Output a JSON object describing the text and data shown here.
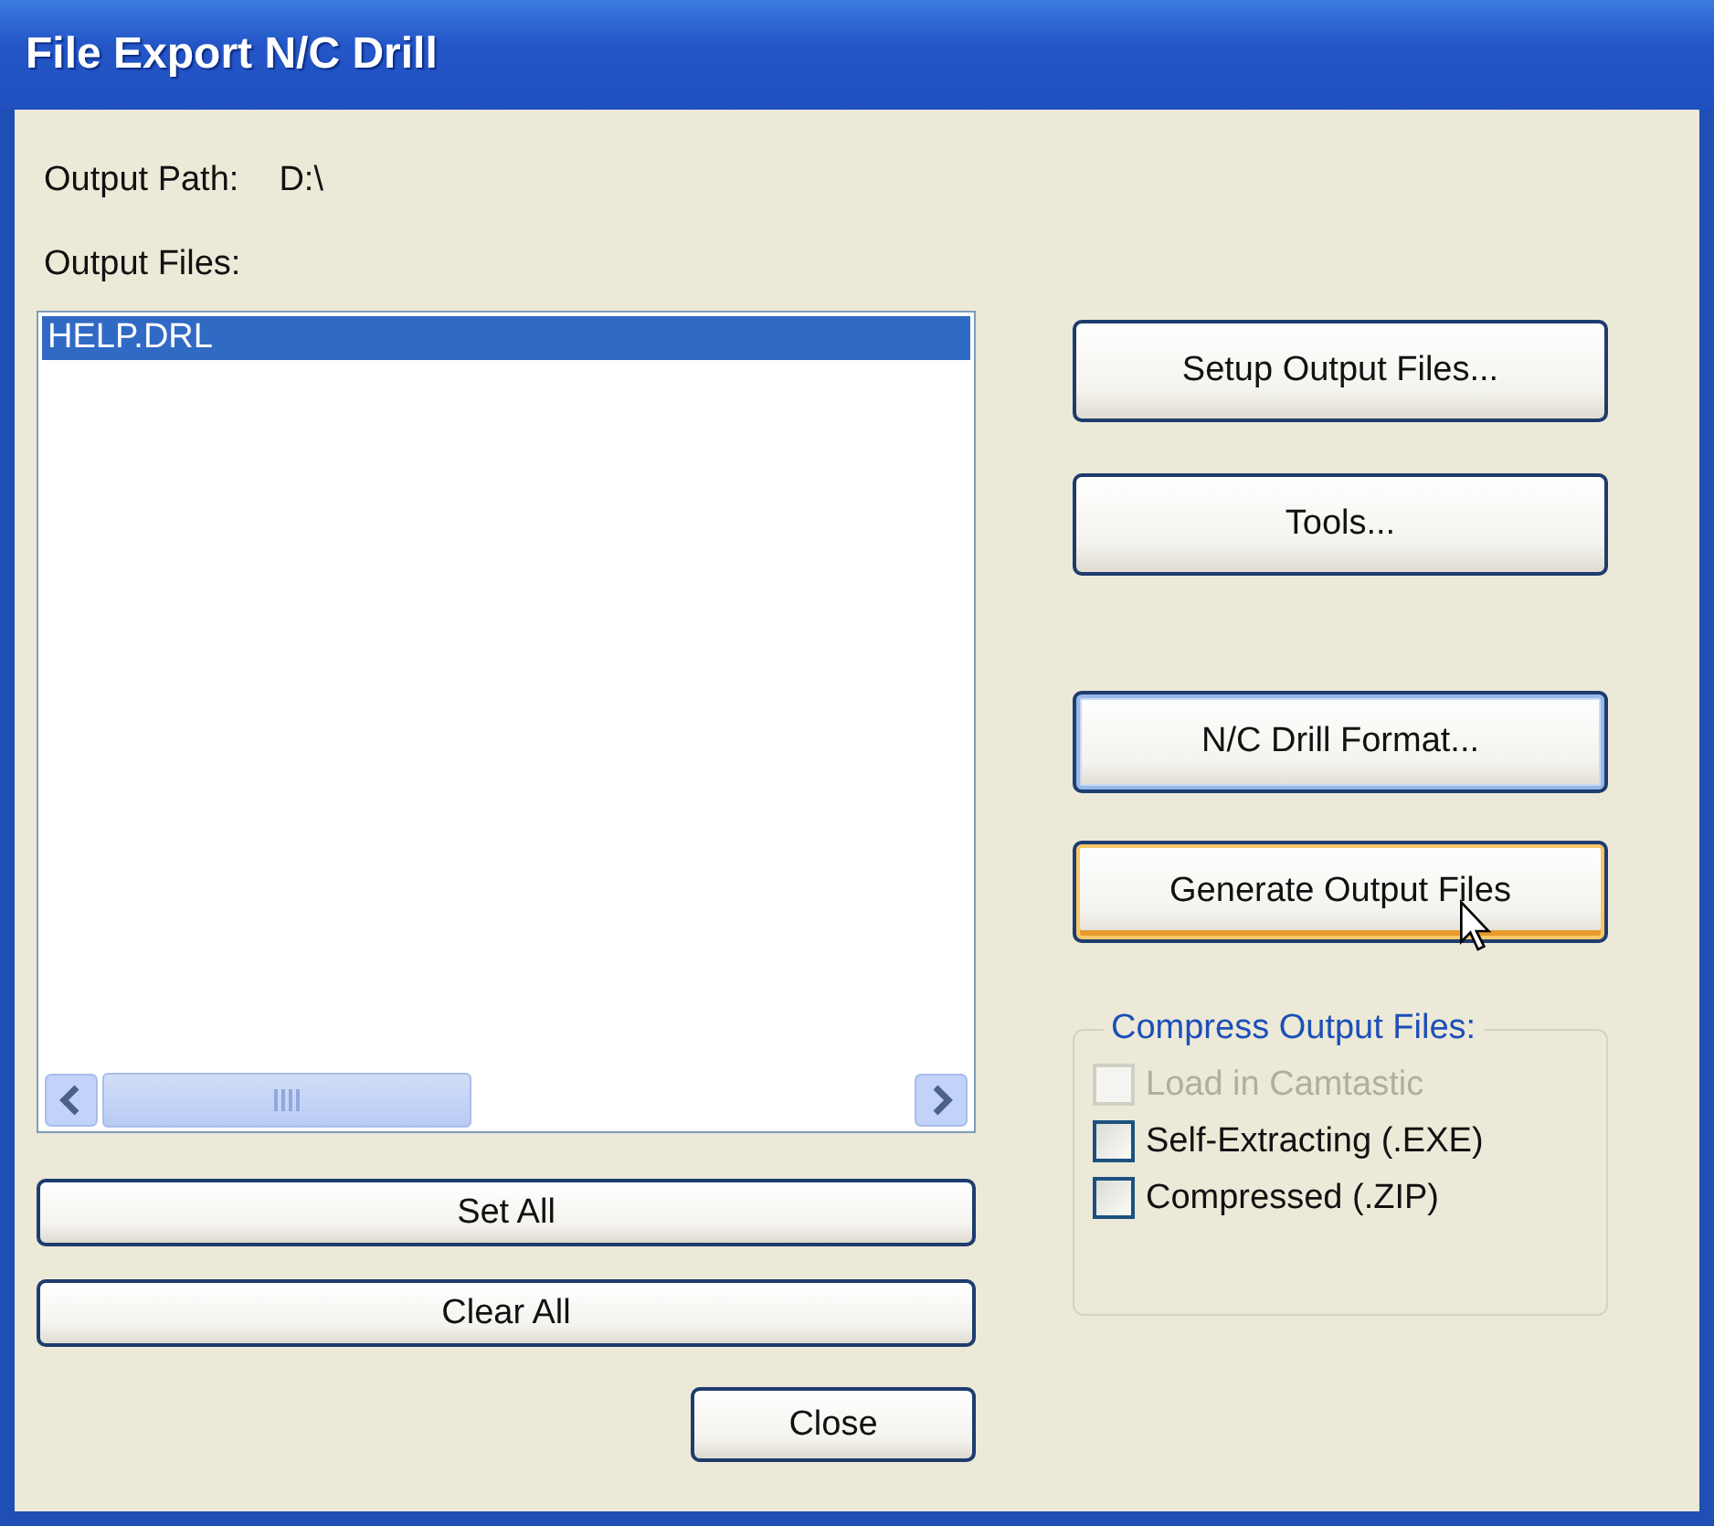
{
  "window": {
    "title": "File Export N/C Drill"
  },
  "output_path": {
    "label": "Output Path:",
    "value": "D:\\"
  },
  "output_files": {
    "label": "Output Files:",
    "items": [
      {
        "name": "HELP.DRL",
        "selected": true
      }
    ]
  },
  "list_buttons": [
    "Set All",
    "Clear All"
  ],
  "close_button": "Close",
  "side_buttons": [
    {
      "label": "Setup Output Files...",
      "focused": false,
      "hot": false
    },
    {
      "label": "Tools...",
      "focused": false,
      "hot": false
    },
    {
      "label": "N/C Drill Format...",
      "focused": true,
      "hot": false
    },
    {
      "label": "Generate Output Files",
      "focused": false,
      "hot": true
    }
  ],
  "compress": {
    "title": "Compress Output Files:",
    "options": [
      {
        "label": "Load in Camtastic",
        "checked": false,
        "disabled": true
      },
      {
        "label": "Self-Extracting (.EXE)",
        "checked": false,
        "disabled": false
      },
      {
        "label": "Compressed (.ZIP)",
        "checked": false,
        "disabled": false
      }
    ]
  }
}
